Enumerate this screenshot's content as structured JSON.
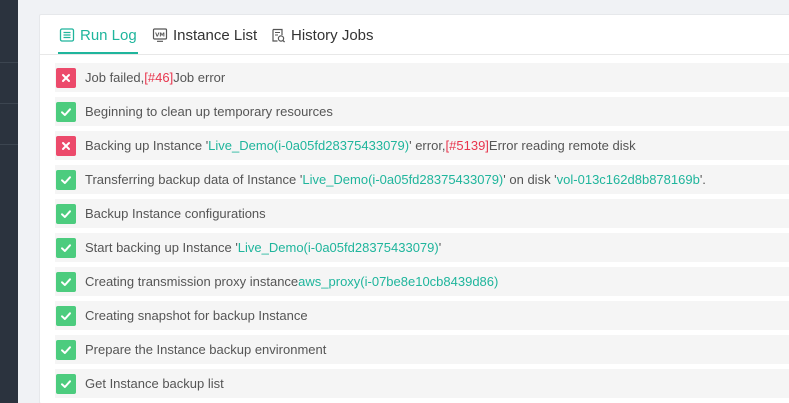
{
  "tabs": [
    {
      "label": "Run Log",
      "icon": "log-icon",
      "active": true
    },
    {
      "label": "Instance List",
      "icon": "vm-icon",
      "active": false
    },
    {
      "label": "History Jobs",
      "icon": "history-icon",
      "active": false
    }
  ],
  "colors": {
    "accent": "#1fb59c",
    "fail": "#ec4a6b",
    "success": "#4ccc7e",
    "error_code": "#e8354d"
  },
  "logs": [
    {
      "status": "fail",
      "parts": [
        {
          "text": "Job failed,",
          "style": ""
        },
        {
          "text": "[#46]",
          "style": "err"
        },
        {
          "text": "Job error",
          "style": ""
        }
      ]
    },
    {
      "status": "ok",
      "parts": [
        {
          "text": "Beginning to clean up temporary resources",
          "style": ""
        }
      ]
    },
    {
      "status": "fail",
      "parts": [
        {
          "text": "Backing up Instance '",
          "style": ""
        },
        {
          "text": "Live_Demo(i-0a05fd28375433079)",
          "style": "hl"
        },
        {
          "text": "' error,",
          "style": ""
        },
        {
          "text": "[#5139]",
          "style": "err"
        },
        {
          "text": "Error reading remote disk",
          "style": ""
        }
      ]
    },
    {
      "status": "ok",
      "parts": [
        {
          "text": "Transferring backup data of Instance '",
          "style": ""
        },
        {
          "text": "Live_Demo(i-0a05fd28375433079)",
          "style": "hl"
        },
        {
          "text": "' on disk '",
          "style": ""
        },
        {
          "text": "vol-013c162d8b878169b",
          "style": "hl"
        },
        {
          "text": "'.",
          "style": ""
        }
      ]
    },
    {
      "status": "ok",
      "parts": [
        {
          "text": "Backup Instance configurations",
          "style": ""
        }
      ]
    },
    {
      "status": "ok",
      "parts": [
        {
          "text": "Start backing up Instance '",
          "style": ""
        },
        {
          "text": "Live_Demo(i-0a05fd28375433079)",
          "style": "hl"
        },
        {
          "text": "'",
          "style": ""
        }
      ]
    },
    {
      "status": "ok",
      "parts": [
        {
          "text": "Creating transmission proxy instance",
          "style": ""
        },
        {
          "text": "aws_proxy(i-07be8e10cb8439d86)",
          "style": "hl"
        }
      ]
    },
    {
      "status": "ok",
      "parts": [
        {
          "text": "Creating snapshot for backup Instance",
          "style": ""
        }
      ]
    },
    {
      "status": "ok",
      "parts": [
        {
          "text": "Prepare the Instance backup environment",
          "style": ""
        }
      ]
    },
    {
      "status": "ok",
      "parts": [
        {
          "text": "Get Instance backup list",
          "style": ""
        }
      ]
    }
  ]
}
